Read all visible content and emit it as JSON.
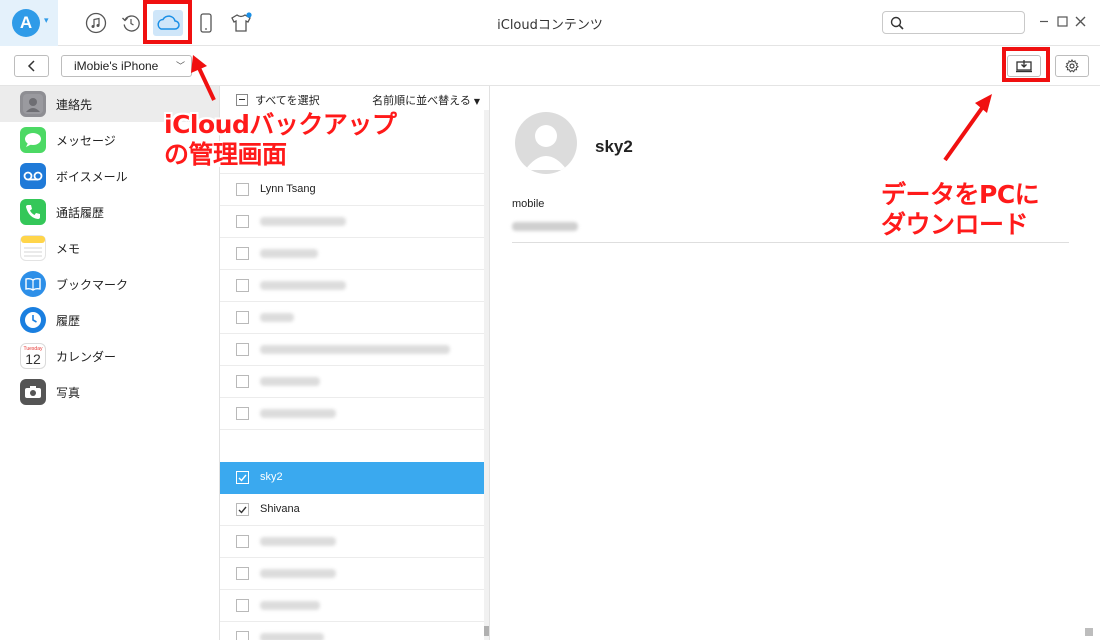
{
  "window": {
    "title": "iCloudコンテンツ",
    "search_placeholder": "",
    "title_icons": [
      "music-icon",
      "restore-icon",
      "icloud-icon",
      "phone-icon",
      "tshirt-icon"
    ]
  },
  "toolbar": {
    "device_name": "iMobie's iPhone",
    "buttons": [
      "back-arrow-icon",
      "download-to-pc-icon",
      "gear-icon"
    ]
  },
  "sidebar": {
    "items": [
      {
        "label": "連絡先",
        "icon": "contacts-icon",
        "color": "#8e8e93",
        "selected": true
      },
      {
        "label": "メッセージ",
        "icon": "messages-icon",
        "color": "#4cd964"
      },
      {
        "label": "ボイスメール",
        "icon": "voicemail-icon",
        "color": "#1f7ad8"
      },
      {
        "label": "通話履歴",
        "icon": "phone-call-icon",
        "color": "#34c759"
      },
      {
        "label": "メモ",
        "icon": "notes-icon",
        "color": "#ffd54a"
      },
      {
        "label": "ブックマーク",
        "icon": "bookmark-icon",
        "color": "#2d8fe8"
      },
      {
        "label": "履歴",
        "icon": "history-clock-icon",
        "color": "#1a7fe0"
      },
      {
        "label": "カレンダー",
        "icon": "calendar-icon",
        "calendar_day": "Tuesday",
        "calendar_date": "12"
      },
      {
        "label": "写真",
        "icon": "camera-icon",
        "color": "#555555"
      }
    ]
  },
  "list": {
    "select_all_label": "すべてを選択",
    "sort_label": "名前順に並べ替える",
    "rows": [
      {
        "name": "",
        "checked": false,
        "hidden": true
      },
      {
        "name": "",
        "checked": false
      },
      {
        "name": "Lynn  Tsang",
        "checked": false
      },
      {
        "name": "",
        "checked": false
      },
      {
        "name": "",
        "checked": false
      },
      {
        "name": "",
        "checked": false
      },
      {
        "name": "",
        "checked": false
      },
      {
        "name": "",
        "checked": false
      },
      {
        "name": "",
        "checked": false
      },
      {
        "name": "",
        "checked": false
      },
      {
        "name": "sky2",
        "checked": true,
        "selected": true
      },
      {
        "name": "Shivana",
        "checked": true
      },
      {
        "name": "",
        "checked": false
      },
      {
        "name": "",
        "checked": false
      },
      {
        "name": "",
        "checked": false
      },
      {
        "name": "",
        "checked": false
      }
    ]
  },
  "detail": {
    "name": "sky2",
    "field_label": "mobile"
  },
  "annotations": {
    "left_note": [
      "iCloudバックアップ",
      "の管理画面"
    ],
    "right_note": [
      "データをPCに",
      "ダウンロード"
    ],
    "color": "#f01010"
  }
}
